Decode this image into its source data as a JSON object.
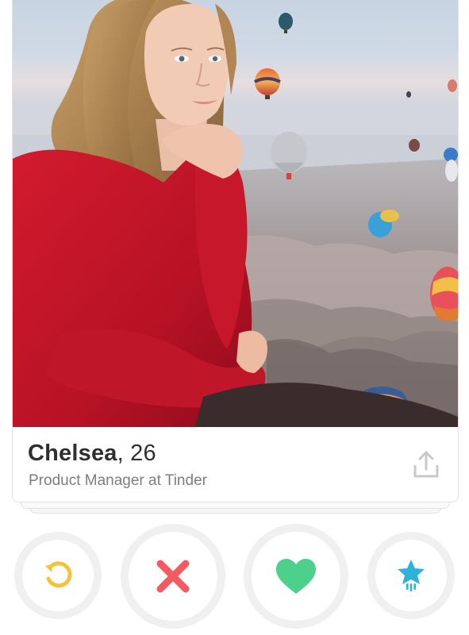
{
  "profile": {
    "name": "Chelsea",
    "age_text": ", 26",
    "job": "Product Manager at Tinder"
  },
  "icons": {
    "share": "share-icon",
    "rewind": "rewind-icon",
    "nope": "close-icon",
    "like": "heart-icon",
    "super_like": "star-icon"
  },
  "colors": {
    "rewind": "#f5c33b",
    "nope": "#f45b61",
    "like": "#4cd08a",
    "super_like": "#2fb2d8",
    "share": "#c8c8c8",
    "name": "#2f2f2f",
    "job": "#7d7d7d"
  }
}
